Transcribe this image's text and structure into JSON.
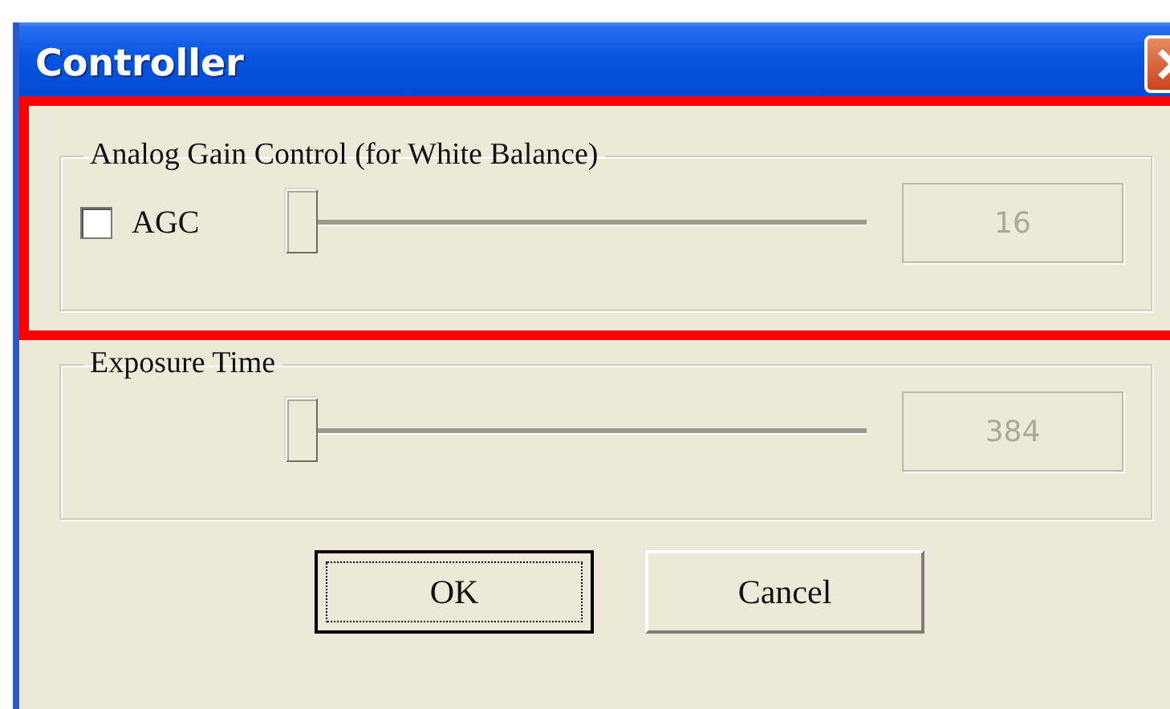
{
  "window": {
    "title": "Controller"
  },
  "highlight": {
    "shown": true
  },
  "groups": [
    {
      "title": "Analog Gain Control (for White Balance)",
      "checkbox": {
        "label": "AGC",
        "checked": false
      },
      "slider": {
        "level": 0
      },
      "value": {
        "text": "16",
        "disabled": true
      }
    },
    {
      "title": "Exposure Time",
      "slider": {
        "level": 0
      },
      "value": {
        "text": "384",
        "disabled": true
      }
    }
  ],
  "buttons": [
    {
      "label": "OK",
      "default": true
    },
    {
      "label": "Cancel",
      "default": false
    }
  ]
}
